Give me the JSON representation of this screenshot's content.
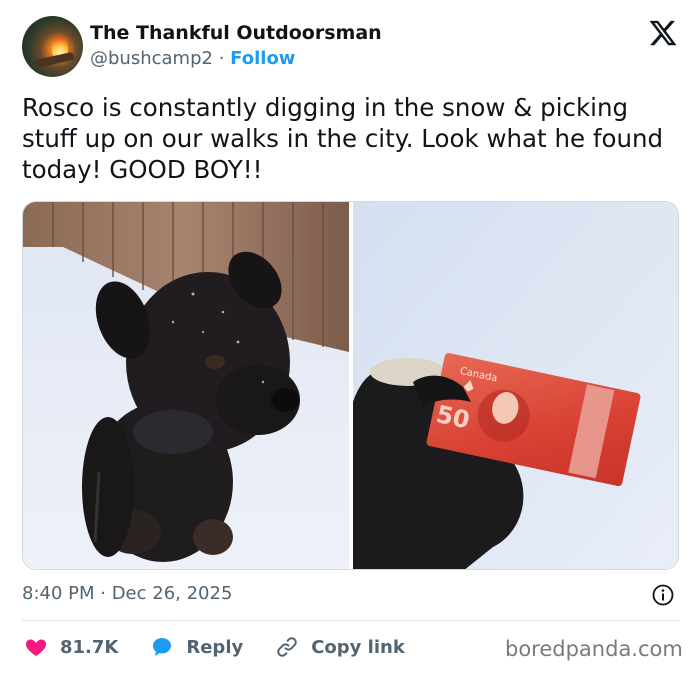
{
  "author": {
    "display_name": "The Thankful Outdoorsman",
    "handle": "@bushcamp2",
    "separator": "·",
    "follow_label": "Follow"
  },
  "platform_icon": "x-logo-icon",
  "tweet": {
    "text": "Rosco is constantly digging in the snow & picking stuff up on our walks in the city.  Look what he found today!  GOOD BOY!!",
    "media": [
      {
        "description_icon": "dog-photo"
      },
      {
        "description_icon": "banknote-photo",
        "note_brand": "Canada",
        "note_value": "50"
      }
    ],
    "timestamp": "8:40 PM · Dec 26, 2025"
  },
  "actions": {
    "like_count": "81.7K",
    "reply_label": "Reply",
    "copy_link_label": "Copy link"
  },
  "colors": {
    "like": "#f91880",
    "reply": "#1d9bf0",
    "follow": "#1d9bf0",
    "muted": "#536471"
  },
  "watermark": "boredpanda.com"
}
